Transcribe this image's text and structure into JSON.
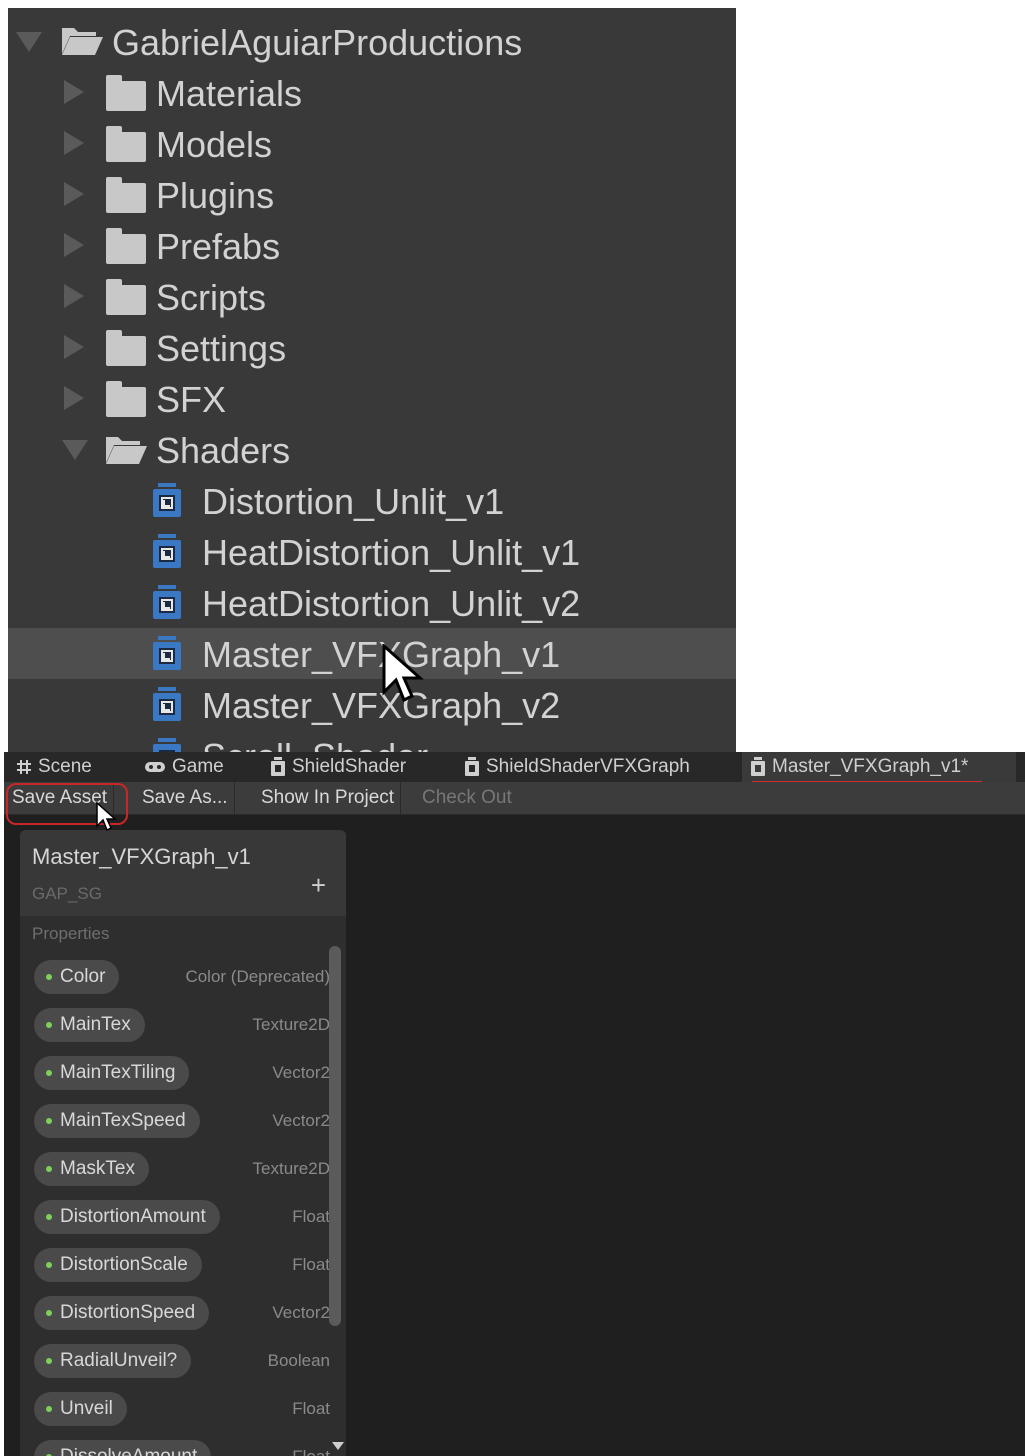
{
  "tree": {
    "root": "GabrielAguiarProductions",
    "folders": [
      "Materials",
      "Models",
      "Plugins",
      "Prefabs",
      "Scripts",
      "Settings",
      "SFX"
    ],
    "open_folder": "Shaders",
    "shaders": [
      "Distortion_Unlit_v1",
      "HeatDistortion_Unlit_v1",
      "HeatDistortion_Unlit_v2",
      "Master_VFXGraph_v1",
      "Master_VFXGraph_v2",
      "Scroll_Shader"
    ],
    "selected": "Master_VFXGraph_v1"
  },
  "tabs": [
    {
      "label": "Scene",
      "icon": "grid-icon"
    },
    {
      "label": "Game",
      "icon": "gamepad-icon"
    },
    {
      "label": "ShieldShader",
      "icon": "shader-graph-icon"
    },
    {
      "label": "ShieldShaderVFXGraph",
      "icon": "shader-graph-icon"
    },
    {
      "label": "Master_VFXGraph_v1*",
      "icon": "shader-graph-icon"
    }
  ],
  "toolbar": {
    "save_asset": "Save Asset",
    "save_as": "Save As...",
    "show_in_project": "Show In Project",
    "check_out": "Check Out"
  },
  "blackboard": {
    "title": "Master_VFXGraph_v1",
    "subtitle": "GAP_SG",
    "add": "+",
    "section": "Properties",
    "properties": [
      {
        "name": "Color",
        "type": "Color (Deprecated)"
      },
      {
        "name": "MainTex",
        "type": "Texture2D"
      },
      {
        "name": "MainTexTiling",
        "type": "Vector2"
      },
      {
        "name": "MainTexSpeed",
        "type": "Vector2"
      },
      {
        "name": "MaskTex",
        "type": "Texture2D"
      },
      {
        "name": "DistortionAmount",
        "type": "Float"
      },
      {
        "name": "DistortionScale",
        "type": "Float"
      },
      {
        "name": "DistortionSpeed",
        "type": "Vector2"
      },
      {
        "name": "RadialUnveil?",
        "type": "Boolean"
      },
      {
        "name": "Unveil",
        "type": "Float"
      },
      {
        "name": "DissolveAmount",
        "type": "Float"
      }
    ]
  },
  "colors": {
    "accent_red": "#d03030",
    "property_dot": "#7fd05a",
    "shader_icon": "#3b78c4"
  }
}
